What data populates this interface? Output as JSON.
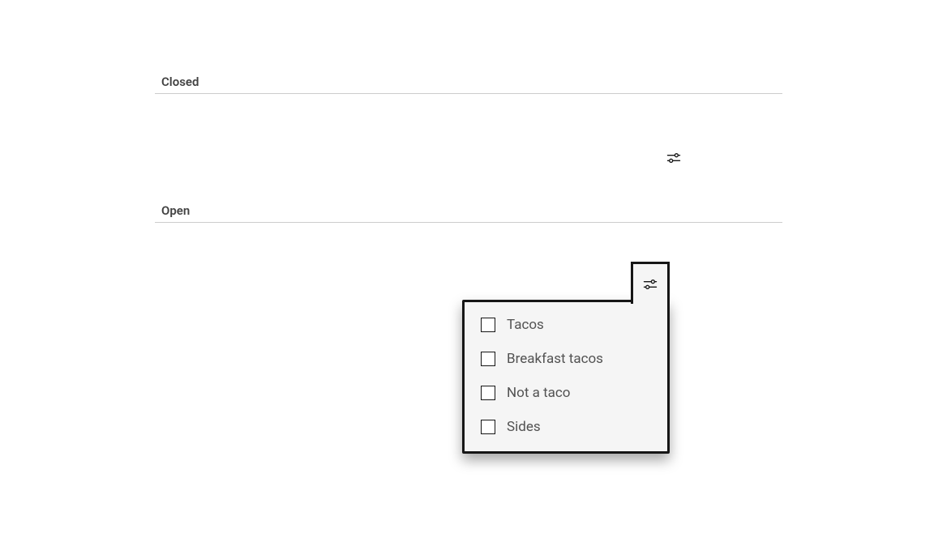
{
  "sections": {
    "closed": {
      "label": "Closed"
    },
    "open": {
      "label": "Open"
    }
  },
  "popover": {
    "items": [
      {
        "label": "Tacos"
      },
      {
        "label": "Breakfast tacos"
      },
      {
        "label": "Not a taco"
      },
      {
        "label": "Sides"
      }
    ]
  }
}
